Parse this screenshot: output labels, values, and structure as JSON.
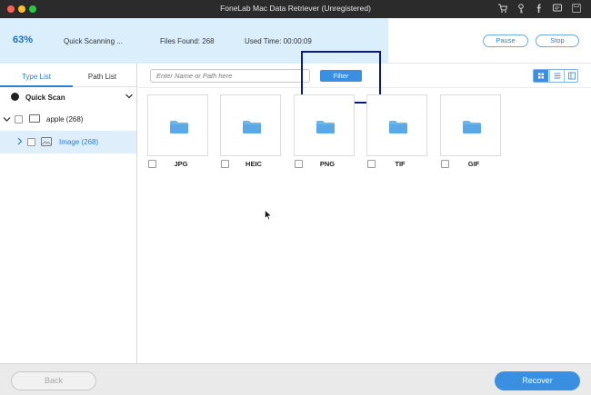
{
  "window": {
    "title": "FoneLab Mac Data Retriever (Unregistered)"
  },
  "scan": {
    "percent_label": "63%",
    "progress": 0.63,
    "status": "Quick Scanning ...",
    "files_found": "Files Found: 268",
    "used_time": "Used Time: 00:00:09",
    "pause_label": "Pause",
    "stop_label": "Stop"
  },
  "sidebar": {
    "tabs": [
      "Type List",
      "Path List"
    ],
    "quick_scan_label": "Quick Scan",
    "drive_label": "apple (268)",
    "category_label": "Image (268)"
  },
  "toolbar": {
    "search_placeholder": "Enter Name or Path here",
    "filter_label": "Filter"
  },
  "file_types": [
    {
      "label": "JPG"
    },
    {
      "label": "HEIC"
    },
    {
      "label": "PNG"
    },
    {
      "label": "TIF"
    },
    {
      "label": "GIF"
    }
  ],
  "footer": {
    "back_label": "Back",
    "recover_label": "Recover"
  },
  "colors": {
    "accent": "#3a8fe0",
    "progress_bg": "#dbeefc",
    "folder": "#6cb6ee",
    "highlight_box": "#0d1a7a"
  }
}
